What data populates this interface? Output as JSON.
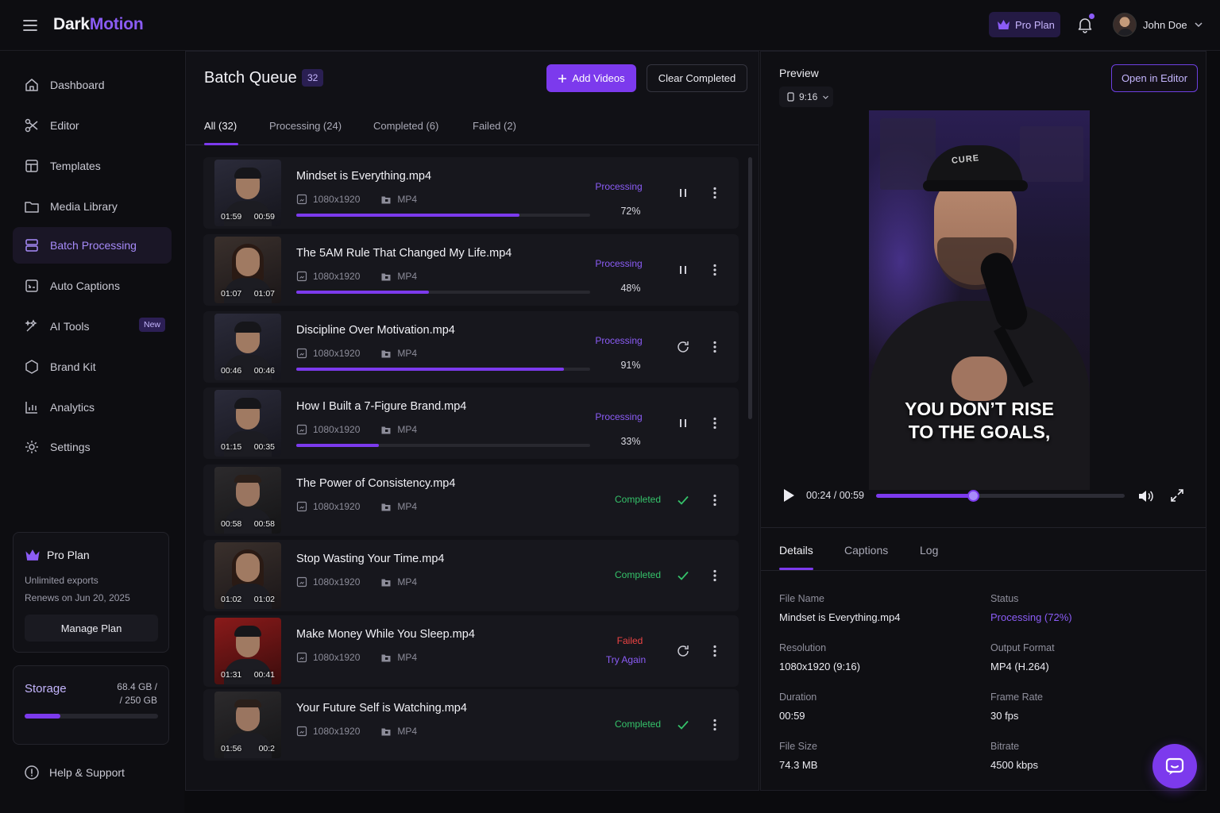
{
  "app": {
    "logo_dark": "Dark",
    "logo_motion": "Motion"
  },
  "header": {
    "plan_badge": "Pro Plan",
    "user_name": "John Doe"
  },
  "sidebar": {
    "items": [
      {
        "label": "Dashboard",
        "icon": "home-icon"
      },
      {
        "label": "Editor",
        "icon": "scissors-icon"
      },
      {
        "label": "Templates",
        "icon": "templates-icon"
      },
      {
        "label": "Media Library",
        "icon": "folder-icon"
      },
      {
        "label": "Batch Processing",
        "icon": "batch-icon",
        "active": true
      },
      {
        "label": "Auto Captions",
        "icon": "captions-icon"
      },
      {
        "label": "AI Tools",
        "icon": "ai-tools-icon",
        "badge": "New"
      },
      {
        "label": "Brand Kit",
        "icon": "brand-kit-icon"
      },
      {
        "label": "Analytics",
        "icon": "analytics-icon"
      },
      {
        "label": "Settings",
        "icon": "gear-icon"
      }
    ],
    "plan": {
      "title": "Pro Plan",
      "line1": "Unlimited exports",
      "line2": "Renews on Jun 20, 2025",
      "button": "Manage Plan"
    },
    "storage": {
      "title": "Storage",
      "used": "68.4 GB /",
      "total": "/ 250 GB",
      "fraction": 0.27
    },
    "help": "Help & Support"
  },
  "queue": {
    "title": "Batch Queue",
    "count": "32",
    "add_button": "Add Videos",
    "clear_button": "Clear Completed",
    "tabs": [
      "All (32)",
      "Processing (24)",
      "Completed (6)",
      "Failed (2)"
    ],
    "rows": [
      {
        "title": "Mindset is Everything.mp4",
        "resolution": "1080x1920",
        "format": "MP4",
        "tc_left": "01:59",
        "tc_right": "00:59",
        "status": "Processing",
        "percent": "72%",
        "progress": 0.76,
        "action": "pause",
        "thumb": "cap"
      },
      {
        "title": "The 5AM Rule That Changed My Life.mp4",
        "resolution": "1080x1920",
        "format": "MP4",
        "tc_left": "01:07",
        "tc_right": "01:07",
        "status": "Processing",
        "percent": "48%",
        "progress": 0.45,
        "action": "pause",
        "thumb": "woman"
      },
      {
        "title": "Discipline Over Motivation.mp4",
        "resolution": "1080x1920",
        "format": "MP4",
        "tc_left": "00:46",
        "tc_right": "00:46",
        "status": "Processing",
        "percent": "91%",
        "progress": 0.91,
        "action": "retry",
        "thumb": "cap"
      },
      {
        "title": "How I Built a 7-Figure Brand.mp4",
        "resolution": "1080x1920",
        "format": "MP4",
        "tc_left": "01:15",
        "tc_right": "00:35",
        "status": "Processing",
        "percent": "33%",
        "progress": 0.28,
        "action": "pause",
        "thumb": "cap"
      },
      {
        "title": "The Power of Consistency.mp4",
        "resolution": "1080x1920",
        "format": "MP4",
        "tc_left": "00:58",
        "tc_right": "00:58",
        "status": "Completed",
        "action": "check",
        "thumb": "plain"
      },
      {
        "title": "Stop Wasting Your Time.mp4",
        "resolution": "1080x1920",
        "format": "MP4",
        "tc_left": "01:02",
        "tc_right": "01:02",
        "status": "Completed",
        "action": "check",
        "thumb": "woman"
      },
      {
        "title": "Make Money While You Sleep.mp4",
        "resolution": "1080x1920",
        "format": "MP4",
        "tc_left": "01:31",
        "tc_right": "00:41",
        "status": "Failed",
        "retry_label": "Try Again",
        "action": "retry",
        "thumb": "red"
      },
      {
        "title": "Your Future Self is Watching.mp4",
        "resolution": "1080x1920",
        "format": "MP4",
        "tc_left": "01:56",
        "tc_right": "00:2",
        "status": "Completed",
        "action": "check",
        "thumb": "plain"
      }
    ]
  },
  "preview": {
    "title": "Preview",
    "ratio": "9:16",
    "open_button": "Open in Editor",
    "cap_brand": "CURE",
    "caption_line1": "YOU DON’T RISE",
    "caption_line2": "TO THE GOALS,",
    "current_time": "00:24",
    "duration_time": "00:59",
    "position_fraction": 0.39,
    "tabs": [
      "Details",
      "Captions",
      "Log"
    ],
    "details": [
      {
        "label": "File Name",
        "value": "Mindset is Everything.mp4"
      },
      {
        "label": "Status",
        "value": "Processing (72%)",
        "accent": true
      },
      {
        "label": "Resolution",
        "value": "1080x1920 (9:16)"
      },
      {
        "label": "Output Format",
        "value": "MP4 (H.264)"
      },
      {
        "label": "Duration",
        "value": "00:59"
      },
      {
        "label": "Frame Rate",
        "value": "30 fps"
      },
      {
        "label": "File Size",
        "value": "74.3 MB"
      },
      {
        "label": "Bitrate",
        "value": "4500 kbps"
      }
    ]
  },
  "colors": {
    "accent": "#7c3aed",
    "accent_light": "#8b5cf6",
    "success": "#35c26a",
    "danger": "#ef4444",
    "background": "#0b0b0e"
  }
}
